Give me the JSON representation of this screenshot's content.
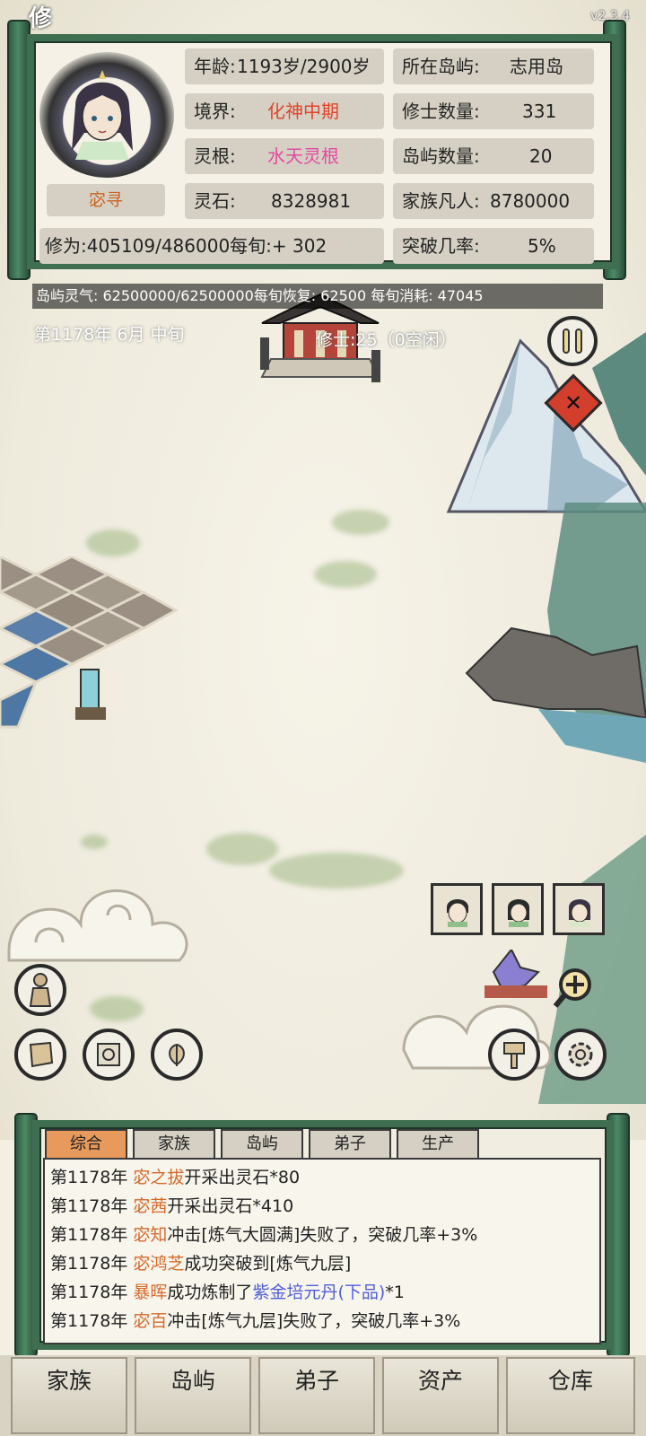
{
  "version": "v2.3.4",
  "title_char": "修",
  "player": {
    "name": "宓寻",
    "age_label": "年龄:",
    "age_value": "1193岁/2900岁",
    "realm_label": "境界:",
    "realm_value": "化神中期",
    "root_label": "灵根:",
    "root_value": "水天灵根",
    "stones_label": "灵石:",
    "stones_value": "8328981",
    "cultivation_text": "修为:405109/486000每旬:+ 302"
  },
  "island": {
    "location_label": "所在岛屿:",
    "location_value": "志用岛",
    "cultivators_label": "修士数量:",
    "cultivators_value": "331",
    "islands_label": "岛屿数量:",
    "islands_value": "20",
    "mortals_label": "家族凡人:",
    "mortals_value": "8780000",
    "breakthrough_label": "突破几率:",
    "breakthrough_value": "5%"
  },
  "aura_bar": "岛屿灵气: 62500000/62500000每旬恢复: 62500 每旬消耗: 47045",
  "date_text": "第1178年 6月 中旬",
  "cultivator_count_text": "修士:25（0空闲）",
  "tabs": [
    {
      "label": "综合"
    },
    {
      "label": "家族"
    },
    {
      "label": "岛屿"
    },
    {
      "label": "弟子"
    },
    {
      "label": "生产"
    }
  ],
  "log": [
    {
      "year": "第1178年",
      "name": "宓之拔",
      "text": "开采出灵石*80"
    },
    {
      "year": "第1178年",
      "name": "宓茜",
      "text": "开采出灵石*410"
    },
    {
      "year": "第1178年",
      "name": "宓知",
      "text": "冲击[炼气大圆满]失败了，突破几率+3%"
    },
    {
      "year": "第1178年",
      "name": "宓鸿芝",
      "text": "成功突破到[炼气九层]"
    },
    {
      "year": "第1178年",
      "name": "暴晖",
      "text": "成功炼制了",
      "item": "紫金培元丹(下品)",
      "suffix": "*1"
    },
    {
      "year": "第1178年",
      "name": "宓百",
      "text": "冲击[炼气九层]失败了，突破几率+3%"
    }
  ],
  "nav": [
    {
      "label": "家族"
    },
    {
      "label": "岛屿"
    },
    {
      "label": "弟子"
    },
    {
      "label": "资产"
    },
    {
      "label": "仓库"
    }
  ],
  "icons": {
    "pause": "pause-icon",
    "close": "close-icon",
    "zoom": "zoom-icon",
    "hammer": "hammer-icon",
    "settings": "settings-icon"
  },
  "colors": {
    "scroll_green": "#3f6e50",
    "name_orange": "#d5692b",
    "realm_red": "#e0452b",
    "root_pink": "#e24aa0",
    "item_blue": "#4f5fd7",
    "tab_active": "#e89a5c"
  }
}
